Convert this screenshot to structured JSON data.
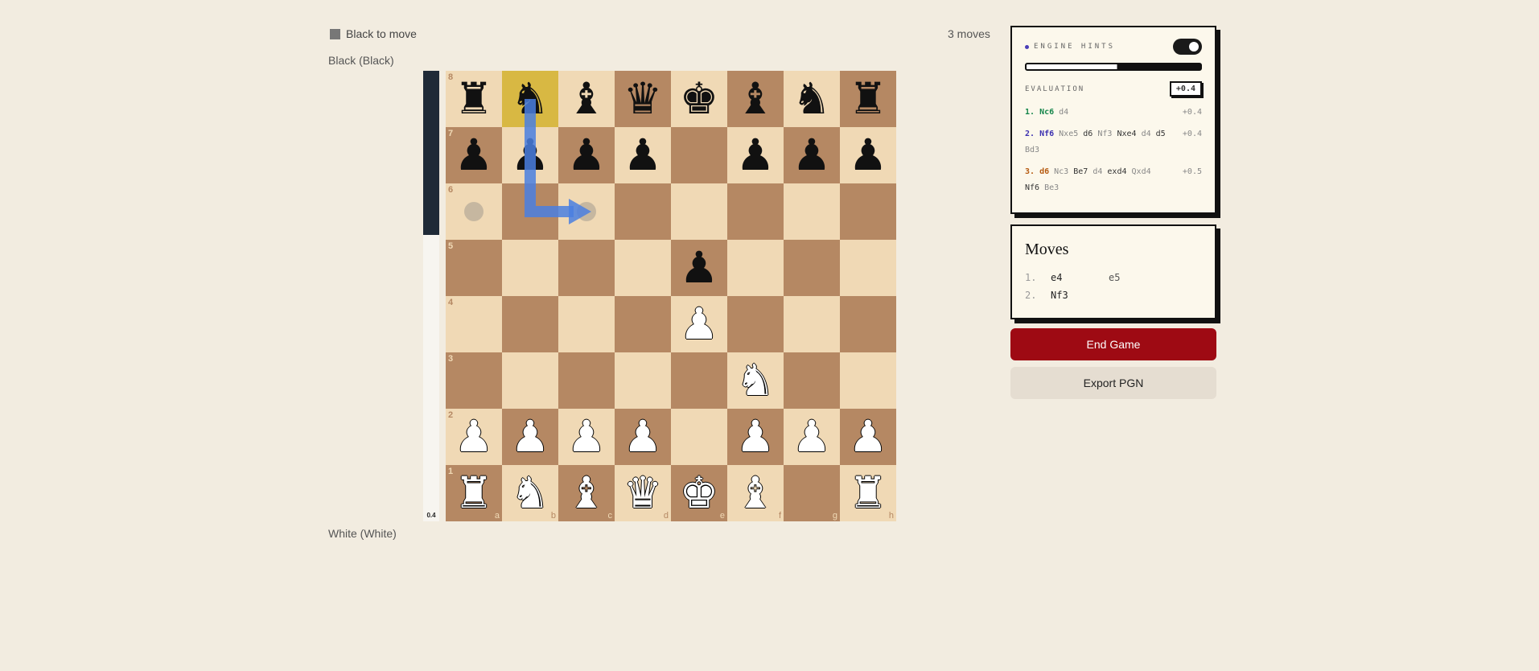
{
  "status": {
    "text": "Black to move"
  },
  "move_count": "3 moves",
  "players": {
    "black": "Black (Black)",
    "white": "White (White)"
  },
  "eval_bar": {
    "value_label": "0.4",
    "black_fraction": 0.365
  },
  "board": {
    "ranks": [
      "8",
      "7",
      "6",
      "5",
      "4",
      "3",
      "2",
      "1"
    ],
    "files": [
      "a",
      "b",
      "c",
      "d",
      "e",
      "f",
      "g",
      "h"
    ],
    "position": [
      [
        "bR",
        "bN",
        "bB",
        "bQ",
        "bK",
        "bB",
        "bN",
        "bR"
      ],
      [
        "bP",
        "bP",
        "bP",
        "bP",
        "",
        "bP",
        "bP",
        "bP"
      ],
      [
        "",
        "",
        "",
        "",
        "",
        "",
        "",
        ""
      ],
      [
        "",
        "",
        "",
        "",
        "bP",
        "",
        "",
        ""
      ],
      [
        "",
        "",
        "",
        "",
        "wP",
        "",
        "",
        ""
      ],
      [
        "",
        "",
        "",
        "",
        "",
        "wN",
        "",
        ""
      ],
      [
        "wP",
        "wP",
        "wP",
        "wP",
        "",
        "wP",
        "wP",
        "wP"
      ],
      [
        "wR",
        "wN",
        "wB",
        "wQ",
        "wK",
        "wB",
        "",
        "wR"
      ]
    ],
    "highlight": "b8",
    "move_dots": [
      "a6",
      "c6"
    ],
    "arrow": {
      "from": "b8",
      "to": "c6",
      "color": "#4a7fe0"
    }
  },
  "engine": {
    "title": "ENGINE HINTS",
    "toggle_on": true,
    "bar_white_fraction": 0.52,
    "evaluation_label": "EVALUATION",
    "evaluation": "+0.4",
    "lines": [
      {
        "num": "1.",
        "first": "Nc6",
        "rest": [
          [
            "d4",
            false
          ]
        ],
        "score": "+0.4",
        "color": "c1"
      },
      {
        "num": "2.",
        "first": "Nf6",
        "rest": [
          [
            "Nxe5",
            false
          ],
          [
            "d6",
            true
          ],
          [
            "Nf3",
            false
          ],
          [
            "Nxe4",
            true
          ],
          [
            "d4",
            false
          ],
          [
            "d5",
            true
          ],
          [
            "Bd3",
            false
          ]
        ],
        "score": "+0.4",
        "color": "c2"
      },
      {
        "num": "3.",
        "first": "d6",
        "rest": [
          [
            "Nc3",
            false
          ],
          [
            "Be7",
            true
          ],
          [
            "d4",
            false
          ],
          [
            "exd4",
            true
          ],
          [
            "Qxd4",
            false
          ],
          [
            "Nf6",
            true
          ],
          [
            "Be3",
            false
          ]
        ],
        "score": "+0.5",
        "color": "c3"
      }
    ]
  },
  "moves_panel": {
    "title": "Moves",
    "moves": [
      {
        "num": "1.",
        "white": "e4",
        "black": "e5"
      },
      {
        "num": "2.",
        "white": "Nf3",
        "black": ""
      }
    ]
  },
  "buttons": {
    "end_game": "End Game",
    "export_pgn": "Export PGN"
  },
  "colors": {
    "light_square": "#f0d9b5",
    "dark_square": "#b58863",
    "highlight": "#d8b843",
    "end_button": "#9e0a13"
  }
}
